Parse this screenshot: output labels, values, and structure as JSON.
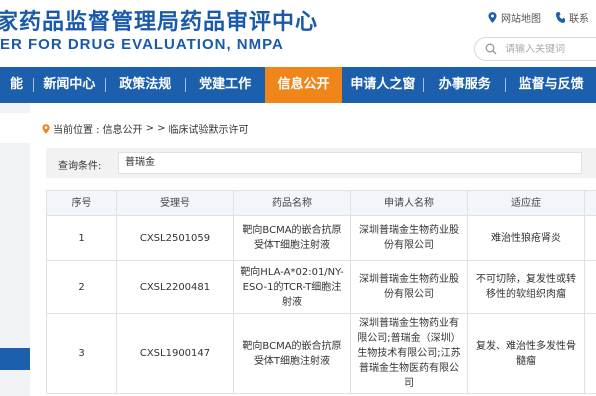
{
  "header": {
    "title_cn": "家药品监督管理局药品审评中心",
    "title_en": "ER FOR DRUG EVALUATION, NMPA",
    "links": {
      "sitemap": "网站地图",
      "contact": "联系"
    },
    "search": {
      "placeholder": "请输入关键词"
    }
  },
  "nav": {
    "items": [
      {
        "label": "能"
      },
      {
        "label": "新闻中心"
      },
      {
        "label": "政策法规"
      },
      {
        "label": "党建工作"
      },
      {
        "label": "信息公开",
        "active": true
      },
      {
        "label": "申请人之窗"
      },
      {
        "label": "办事服务"
      },
      {
        "label": "监督与反馈"
      }
    ]
  },
  "breadcrumb": {
    "prefix": "当前位置 : ",
    "current": "信息公开",
    "sep": ">  >",
    "page": "临床试验默示许可"
  },
  "query": {
    "label": "查询条件:",
    "value": "普瑞金"
  },
  "table": {
    "headers": [
      "序号",
      "受理号",
      "药品名称",
      "申请人名称",
      "适应症"
    ],
    "rows": [
      {
        "no": "1",
        "acceptance_no": "CXSL2501059",
        "drug": "靶向BCMA的嵌合抗原受体T细胞注射液",
        "applicant": "深圳普瑞金生物药业股份有限公司",
        "indication": "难治性狼疮肾炎"
      },
      {
        "no": "2",
        "acceptance_no": "CXSL2200481",
        "drug": "靶向HLA-A*02:01/NY-ESO-1的TCR-T细胞注射液",
        "applicant": "深圳普瑞金生物药业股份有限公司",
        "indication": "不可切除，复发性或转移性的软组织肉瘤"
      },
      {
        "no": "3",
        "acceptance_no": "CXSL1900147",
        "drug": "靶向BCMA的嵌合抗原受体T细胞注射液",
        "applicant": "深圳普瑞金生物药业有限公司;普瑞金（深圳）生物技术有限公司;江苏普瑞金生物医药有限公司",
        "indication": "复发、难治性多发性骨髓瘤"
      }
    ]
  },
  "colors": {
    "brand_blue": "#1c5fad",
    "active_orange": "#f08519"
  }
}
